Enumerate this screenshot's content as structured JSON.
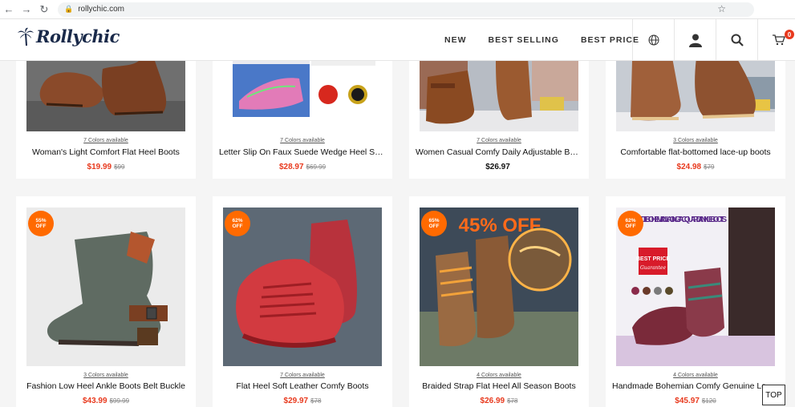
{
  "browser": {
    "url": "rollychic.com"
  },
  "site": {
    "logo_text": "Rollychic",
    "nav": [
      "NEW",
      "BEST SELLING",
      "BEST PRICE"
    ],
    "cart_count": "0"
  },
  "products": [
    {
      "colors": "7 Colors available",
      "name": "Woman's Light Comfort Flat Heel Boots",
      "price": "$19.99",
      "was": "$99"
    },
    {
      "colors": "7 Colors available",
      "name": "Letter Slip On Faux Suede Wedge Heel Sneakers",
      "price": "$28.97",
      "was": "$69.99"
    },
    {
      "colors": "7 Colors available",
      "name": "Women Casual Comfy Daily Adjustable Boots",
      "price": "$26.97",
      "was": ""
    },
    {
      "colors": "3 Colors available",
      "name": "Comfortable flat-bottomed lace-up boots",
      "price": "$24.98",
      "was": "$79"
    },
    {
      "colors": "3 Colors available",
      "name": "Fashion Low Heel Ankle Boots Belt Buckle",
      "price": "$43.99",
      "was": "$99.99",
      "badge": "55%"
    },
    {
      "colors": "7 Colors available",
      "name": "Flat Heel Soft Leather Comfy Boots",
      "price": "$29.97",
      "was": "$78",
      "badge": "62%"
    },
    {
      "colors": "4 Colors available",
      "name": "Braided Strap Flat Heel All Season Boots",
      "price": "$26.99",
      "was": "$78",
      "badge": "65%"
    },
    {
      "colors": "4 Colors available",
      "name": "Handmade Bohemian Comfy Genuine Leather Boots",
      "price": "$45.97",
      "was": "$120",
      "badge": "62%"
    }
  ],
  "badge_off": "OFF",
  "promo": {
    "big_off": "45% OFF",
    "boho_title": "HANDMADE BOHEMIAN LACING JACQUARD ANKLE BOOTS",
    "best_price": "BEST PRICE",
    "guarantee": "Guarantee"
  },
  "top_button": "TOP",
  "colors": {
    "accent": "#e8391d",
    "badge": "#ff6a00"
  }
}
